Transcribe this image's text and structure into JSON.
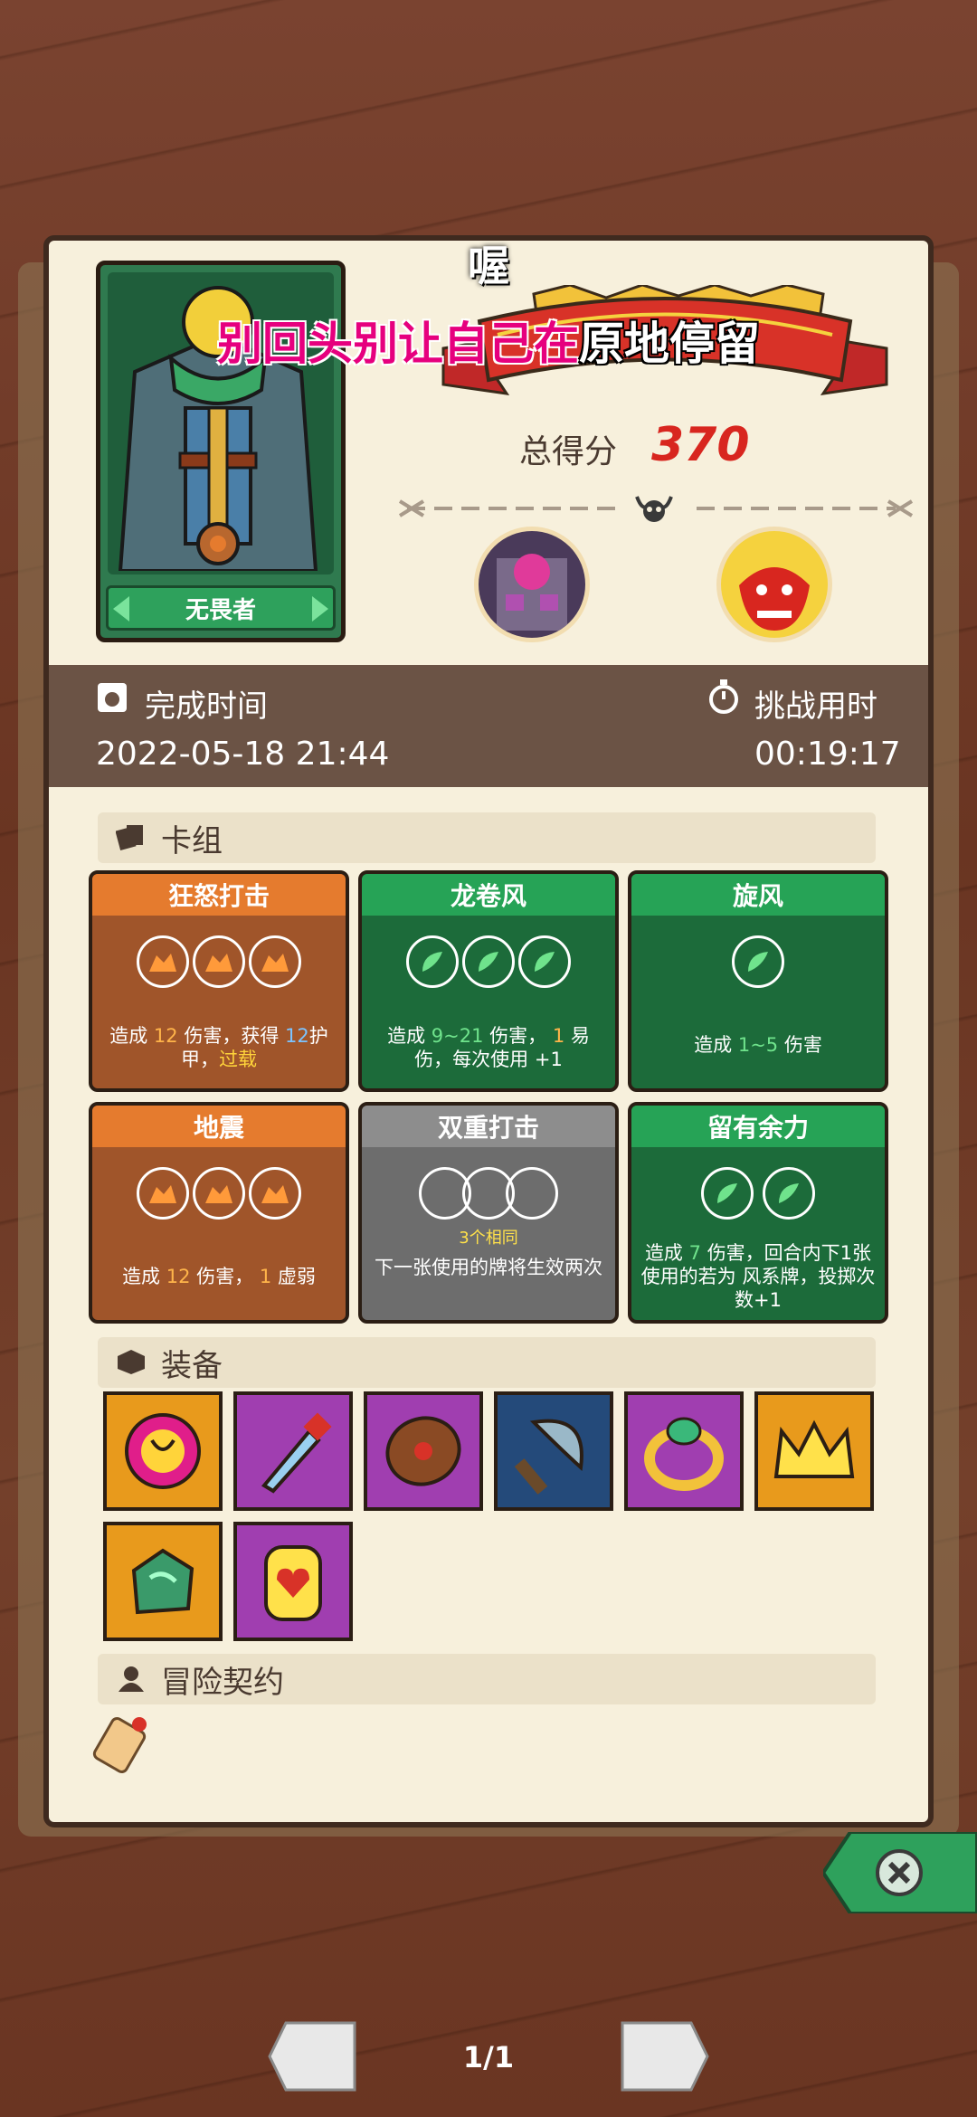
{
  "overlay": {
    "top": "喔",
    "main_pink": "别回头别让自己在",
    "main_white": "原地停留"
  },
  "hero": {
    "name": "无畏者"
  },
  "score": {
    "label": "总得分",
    "value": "370"
  },
  "info": {
    "finish_label": "完成时间",
    "finish_value": "2022-05-18 21:44",
    "challenge_label": "挑战用时",
    "challenge_value": "00:19:17"
  },
  "deck": {
    "header": "卡组",
    "cards": [
      {
        "title": "狂怒打击",
        "desc_a": "造成",
        "n1": "12",
        "desc_b": "伤害，获得",
        "n2": "12",
        "desc_c": "护甲，",
        "tag": "过载"
      },
      {
        "title": "龙卷风",
        "desc_a": "造成",
        "n1": "9~21",
        "desc_b": "伤害，",
        "n2": "1",
        "desc_c": "易伤，每次使用",
        "n3": "+1"
      },
      {
        "title": "旋风",
        "desc_a": "造成",
        "n1": "1~5",
        "desc_b": "伤害"
      },
      {
        "title": "地震",
        "desc_a": "造成",
        "n1": "12",
        "desc_b": "伤害，",
        "n2": "1",
        "desc_c": "虚弱"
      },
      {
        "title": "双重打击",
        "sub": "3个相同",
        "desc": "下一张使用的牌将生效两次"
      },
      {
        "title": "留有余力",
        "desc_a": "造成",
        "n1": "7",
        "desc_b": "伤害，回合内下1张使用的若为",
        "desc_c": "风系牌，投掷次数+1"
      }
    ]
  },
  "equipment": {
    "header": "装备",
    "items": [
      "magic-orb-icon",
      "dagger-icon",
      "shield-icon",
      "blade-icon",
      "ring-icon",
      "crown-icon",
      "emerald-icon",
      "heart-stone-icon"
    ]
  },
  "contract": {
    "header": "冒险契约",
    "items": [
      "scroll-icon"
    ]
  },
  "pager": {
    "label": "1/1"
  },
  "colors": {
    "score": "#d8261f",
    "band": "#6b5345",
    "paper": "#f7f0dc",
    "overlay_pink": "#e6007e"
  }
}
